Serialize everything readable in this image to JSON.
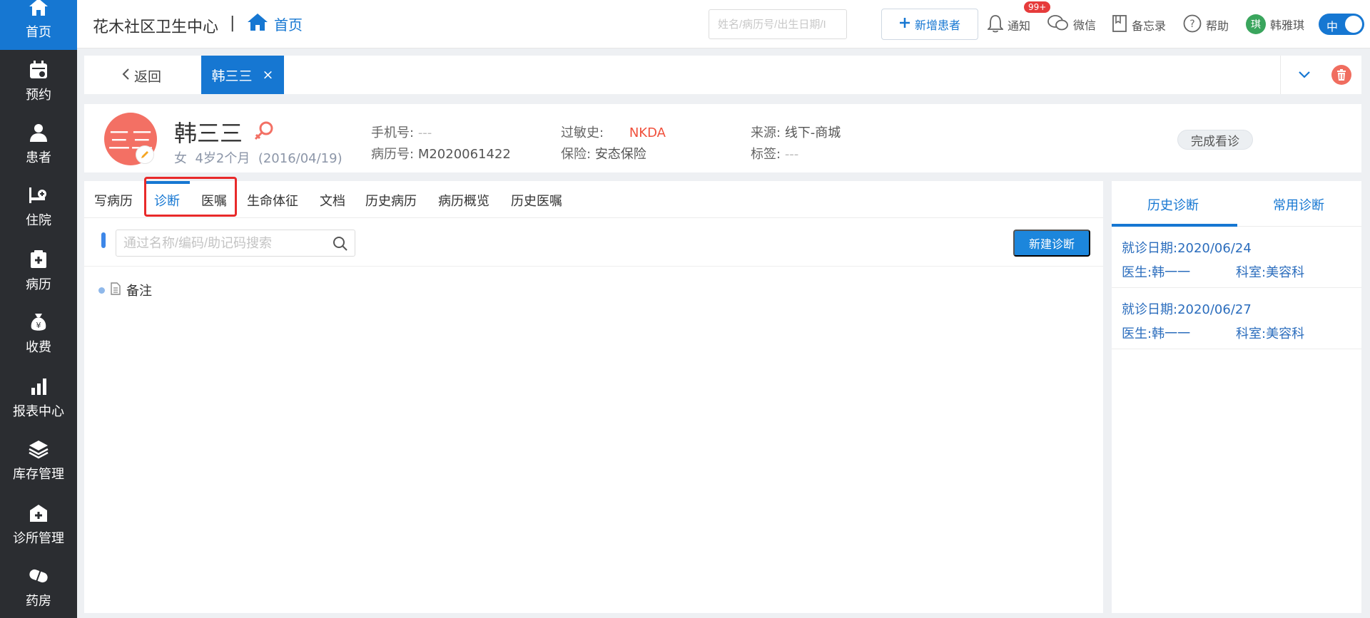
{
  "sidebar": {
    "items": [
      {
        "label": "首页",
        "icon": "home-icon"
      },
      {
        "label": "预约",
        "icon": "calendar-icon"
      },
      {
        "label": "患者",
        "icon": "user-icon"
      },
      {
        "label": "住院",
        "icon": "bed-icon"
      },
      {
        "label": "病历",
        "icon": "medical-record-icon"
      },
      {
        "label": "收费",
        "icon": "money-bag-icon"
      },
      {
        "label": "报表中心",
        "icon": "bar-chart-icon"
      },
      {
        "label": "库存管理",
        "icon": "layers-icon"
      },
      {
        "label": "诊所管理",
        "icon": "clinic-icon"
      },
      {
        "label": "药房",
        "icon": "pill-icon"
      }
    ]
  },
  "header": {
    "clinic_name": "花木社区卫生中心",
    "separator": "|",
    "home_label": "首页",
    "search_placeholder": "姓名/病历号/出生日期/I",
    "new_patient_label": "新增患者",
    "notify_label": "通知",
    "notify_badge": "99+",
    "wechat_label": "微信",
    "memo_label": "备忘录",
    "help_label": "帮助",
    "user_avatar_char": "琪",
    "user_name": "韩雅琪",
    "lang_toggle": "中"
  },
  "tabstrip": {
    "back_label": "返回",
    "active_tab_label": "韩三三",
    "close_symbol": "×"
  },
  "patient": {
    "avatar_text": "三三",
    "name": "韩三三",
    "gender": "女",
    "age": "4岁2个月",
    "birth": "(2016/04/19)",
    "phone_label": "手机号:",
    "phone_value": "---",
    "record_label": "病历号:",
    "record_value": "M2020061422",
    "allergy_label": "过敏史:",
    "allergy_value": "NKDA",
    "insurance_label": "保险:",
    "insurance_value": "安态保险",
    "source_label": "来源:",
    "source_value": "线下-商城",
    "tag_label": "标签:",
    "tag_value": "---",
    "finish_label": "完成看诊"
  },
  "main": {
    "tabs": [
      "写病历",
      "诊断",
      "医嘱",
      "生命体征",
      "文档",
      "历史病历",
      "病历概览",
      "历史医嘱"
    ],
    "active_tab": "诊断",
    "search_placeholder": "通过名称/编码/助记码搜索",
    "new_diagnosis_label": "新建诊断",
    "note_label": "备注"
  },
  "right_panel": {
    "tabs": [
      "历史诊断",
      "常用诊断"
    ],
    "active_tab": "历史诊断",
    "history": [
      {
        "date": "就诊日期:2020/06/24",
        "doctor": "医生:韩一一",
        "dept": "科室:美容科"
      },
      {
        "date": "就诊日期:2020/06/27",
        "doctor": "医生:韩一一",
        "dept": "科室:美容科"
      }
    ]
  },
  "colors": {
    "primary": "#1677d2",
    "sidebar_bg": "#2b2d31",
    "danger": "#f0503c",
    "avatar": "#f37064",
    "highlight_frame": "#e82a2a"
  }
}
